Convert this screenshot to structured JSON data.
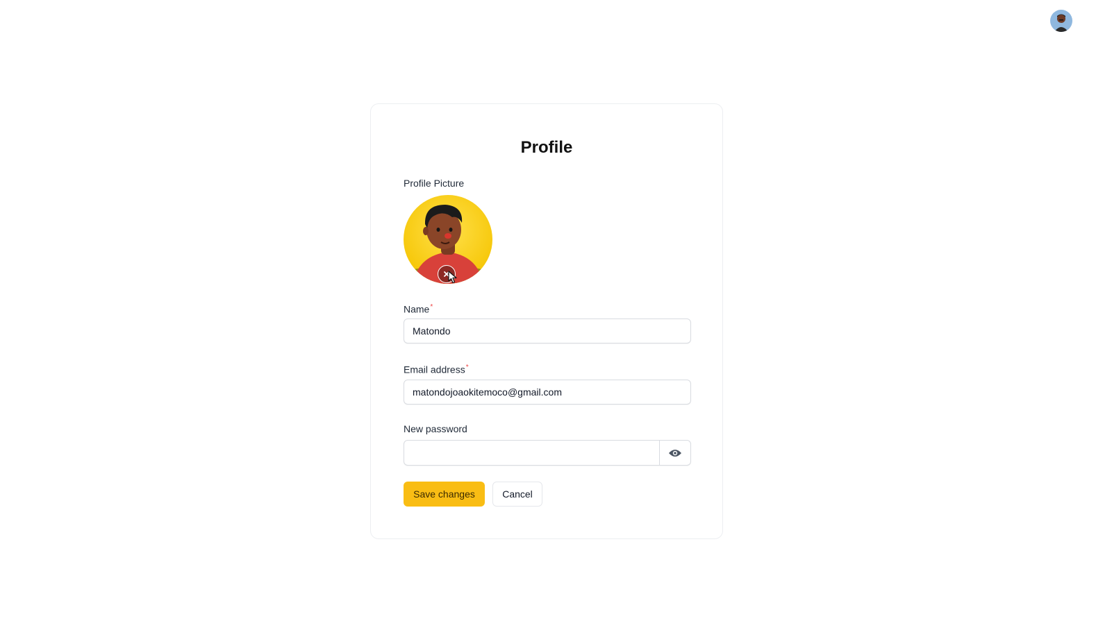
{
  "header": {
    "avatar_icon": "user-avatar-icon"
  },
  "profile": {
    "title": "Profile",
    "picture_label": "Profile Picture",
    "remove_icon": "close-icon",
    "name": {
      "label": "Name",
      "required_mark": "*",
      "value": "Matondo"
    },
    "email": {
      "label": "Email address",
      "required_mark": "*",
      "value": "matondojoaokitemoco@gmail.com"
    },
    "password": {
      "label": "New password",
      "value": "",
      "toggle_icon": "eye-icon"
    },
    "actions": {
      "save_label": "Save changes",
      "cancel_label": "Cancel"
    }
  },
  "colors": {
    "accent": "#f9bd14",
    "required": "#ef4444",
    "avatar_bg": "#fcd535"
  }
}
